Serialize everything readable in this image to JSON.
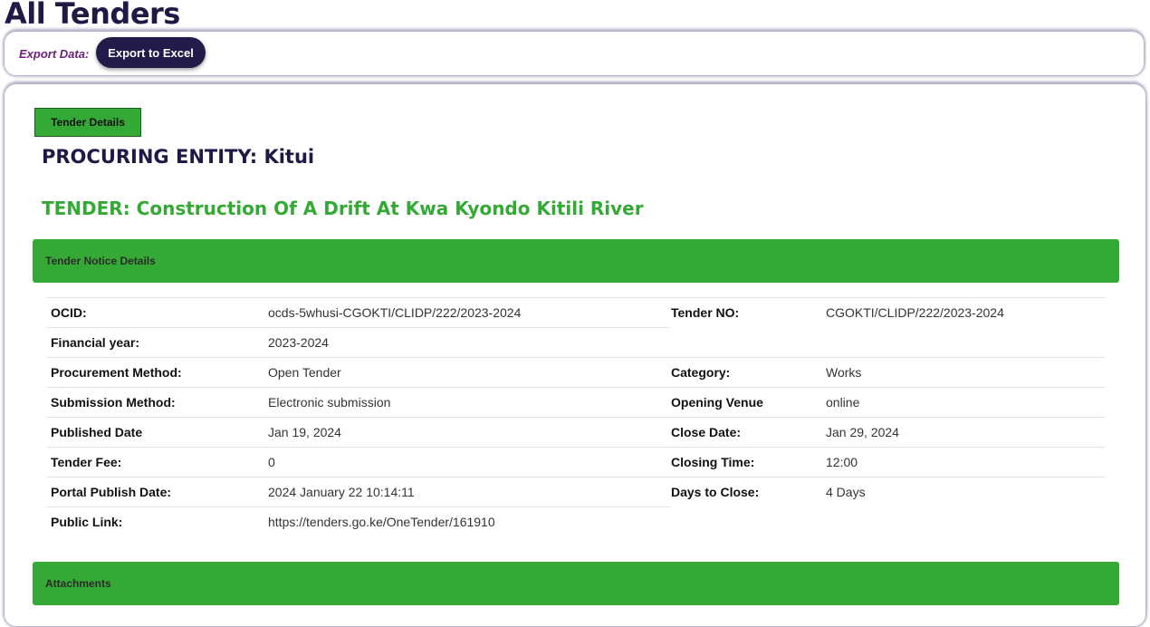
{
  "page": {
    "title": "All Tenders"
  },
  "export": {
    "label": "Export Data:",
    "button": "Export to Excel"
  },
  "tab": {
    "label": "Tender Details"
  },
  "entity": {
    "text": "PROCURING ENTITY: Kitui"
  },
  "tender": {
    "text": "TENDER: Construction Of A Drift At Kwa Kyondo Kitili River"
  },
  "sections": {
    "notice": "Tender Notice Details",
    "attachments": "Attachments"
  },
  "details": {
    "ocid_label": "OCID:",
    "ocid": "ocds-5whusi-CGOKTI/CLIDP/222/2023-2024",
    "tender_no_label": "Tender NO:",
    "tender_no": "CGOKTI/CLIDP/222/2023-2024",
    "fy_label": "Financial year:",
    "fy": "2023-2024",
    "method_label": "Procurement Method:",
    "method": "Open Tender",
    "category_label": "Category:",
    "category": "Works",
    "submission_label": "Submission Method:",
    "submission": "Electronic submission",
    "venue_label": "Opening Venue",
    "venue": "online",
    "published_label": "Published Date",
    "published": "Jan 19, 2024",
    "close_label": "Close Date:",
    "close": "Jan 29, 2024",
    "fee_label": "Tender Fee:",
    "fee": "0",
    "closing_time_label": "Closing Time:",
    "closing_time": "12:00",
    "portal_label": "Portal Publish Date:",
    "portal": "2024 January 22 10:14:11",
    "days_label": "Days to Close:",
    "days": "4 Days",
    "link_label": "Public Link:",
    "link": "https://tenders.go.ke/OneTender/161910"
  }
}
